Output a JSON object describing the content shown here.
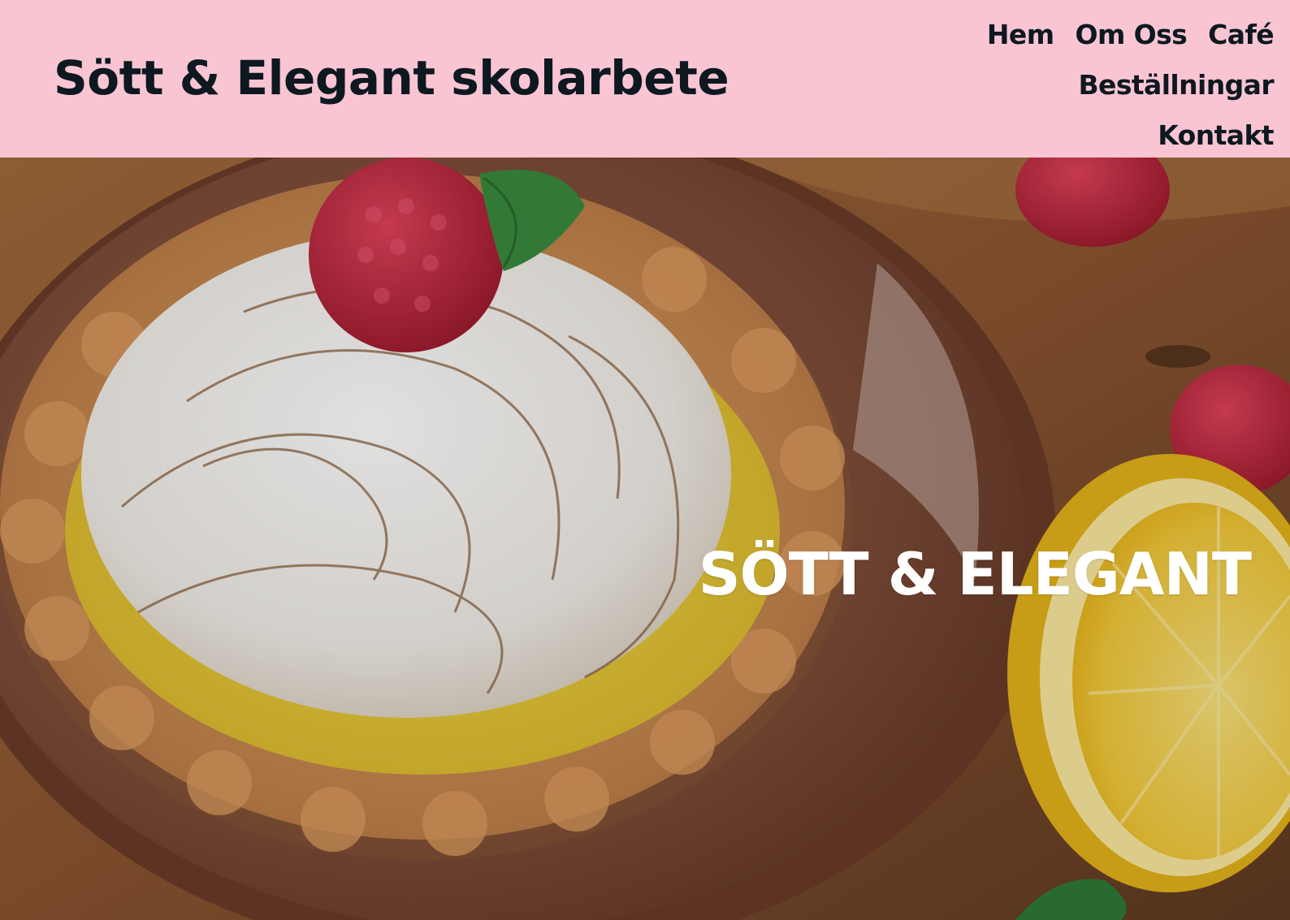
{
  "header": {
    "site_title": "Sött & Elegant skolarbete",
    "background_color": "#f9c5d3",
    "text_color": "#0d1820"
  },
  "nav": {
    "items": [
      {
        "label": "Hem"
      },
      {
        "label": "Om Oss"
      },
      {
        "label": "Café"
      },
      {
        "label": "Beställningar"
      },
      {
        "label": "Kontakt"
      }
    ]
  },
  "hero": {
    "heading": "SÖTT & ELEGANT",
    "image_subject": "lemon meringue tart with raspberry, mint, lemon half and raspberries on a brown plate"
  }
}
